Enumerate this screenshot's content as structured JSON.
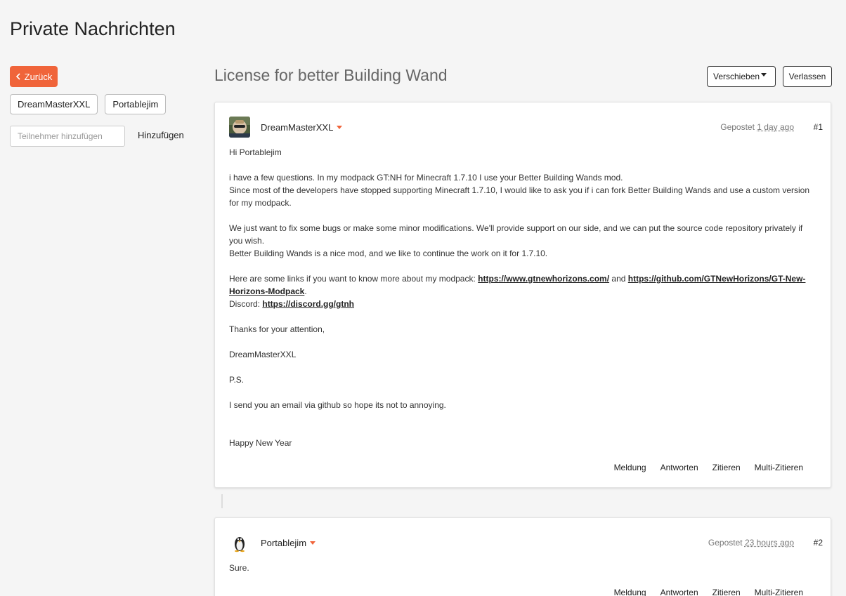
{
  "page": {
    "title": "Private Nachrichten"
  },
  "sidebar": {
    "back_label": "Zurück",
    "participants": [
      "DreamMasterXXL",
      "Portablejim"
    ],
    "add_placeholder": "Teilnehmer hinzufügen",
    "add_label": "Hinzufügen"
  },
  "topic": {
    "title": "License for better Building Wand",
    "move_label": "Verschieben",
    "leave_label": "Verlassen"
  },
  "posts": [
    {
      "author": "DreamMasterXXL",
      "posted_prefix": "Gepostet",
      "time": "1 day ago",
      "number": "#1",
      "greeting": "Hi Portablejim",
      "line1": "i have a few questions. In my modpack GT:NH for Minecraft 1.7.10 I use your Better Building Wands mod.",
      "line2": "Since most of the developers have stopped supporting Minecraft 1.7.10, I would like to ask you if i can fork Better Building Wands and use a custom version for my modpack.",
      "line3": "We just want to fix some bugs or make some minor modifications. We'll provide support on our side, and we can put the source code repository privately if you wish.",
      "line4": "Better Building Wands is a nice mod, and we like to continue the work on it for 1.7.10.",
      "links_intro": "Here are some links if you want to know more about my modpack:",
      "link1": "https://www.gtnewhorizons.com/",
      "and": "and",
      "link2": "https://github.com/GTNewHorizons/GT-New-Horizons-Modpack",
      "period": ".",
      "discord_label": "Discord:",
      "discord_link": "https://discord.gg/gtnh",
      "thanks": "Thanks for your attention,",
      "signature": "DreamMasterXXL",
      "ps": "P.S.",
      "ps_text": "I send you an email via github so hope its not to annoying.",
      "closing": "Happy New Year",
      "actions": [
        "Meldung",
        "Antworten",
        "Zitieren",
        "Multi-Zitieren"
      ]
    },
    {
      "author": "Portablejim",
      "posted_prefix": "Gepostet",
      "time": "23 hours ago",
      "number": "#2",
      "text": "Sure.",
      "actions": [
        "Meldung",
        "Antworten",
        "Zitieren",
        "Multi-Zitieren"
      ]
    }
  ],
  "colors": {
    "accent": "#f0643a",
    "background": "#f5f5f5"
  }
}
